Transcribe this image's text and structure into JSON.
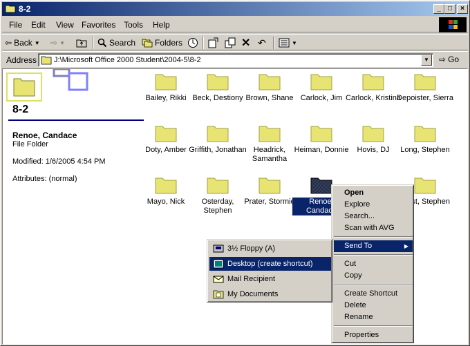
{
  "window": {
    "title": "8-2"
  },
  "menu": [
    "File",
    "Edit",
    "View",
    "Favorites",
    "Tools",
    "Help"
  ],
  "toolbar": {
    "back": "Back",
    "search": "Search",
    "folders": "Folders"
  },
  "address": {
    "label": "Address",
    "value": "J:\\Microsoft Office 2000 Student\\2004-5\\8-2",
    "go": "Go"
  },
  "leftpane": {
    "folder_title": "8-2",
    "selected_name": "Renoe, Candace",
    "selected_type": "File Folder",
    "modified": "Modified: 1/6/2005 4:54 PM",
    "attributes": "Attributes: (normal)"
  },
  "folders": [
    "Bailey, Rikki",
    "Beck, Destiony",
    "Brown, Shane",
    "Carlock, Jim",
    "Carlock, Kristina",
    "Depoister, Sierra",
    "Doty, Amber",
    "Griffith, Jonathan",
    "Headrick, Samantha",
    "Heiman, Donnie",
    "Hovis, DJ",
    "Long, Stephen",
    "Mayo, Nick",
    "Osterday, Stephen",
    "Prater, Stormie",
    "Renoe, Candace",
    "",
    "West, Stephen"
  ],
  "context_menu": {
    "open": "Open",
    "explore": "Explore",
    "search": "Search...",
    "scan": "Scan with AVG",
    "send_to": "Send To",
    "cut": "Cut",
    "copy": "Copy",
    "create_shortcut": "Create Shortcut",
    "delete": "Delete",
    "rename": "Rename",
    "properties": "Properties"
  },
  "send_to_menu": {
    "floppy": "3½ Floppy (A)",
    "desktop": "Desktop (create shortcut)",
    "mail": "Mail Recipient",
    "documents": "My Documents"
  },
  "colors": {
    "selection": "#0a246a",
    "folder": "#e8e474",
    "face": "#d4d0c8"
  }
}
